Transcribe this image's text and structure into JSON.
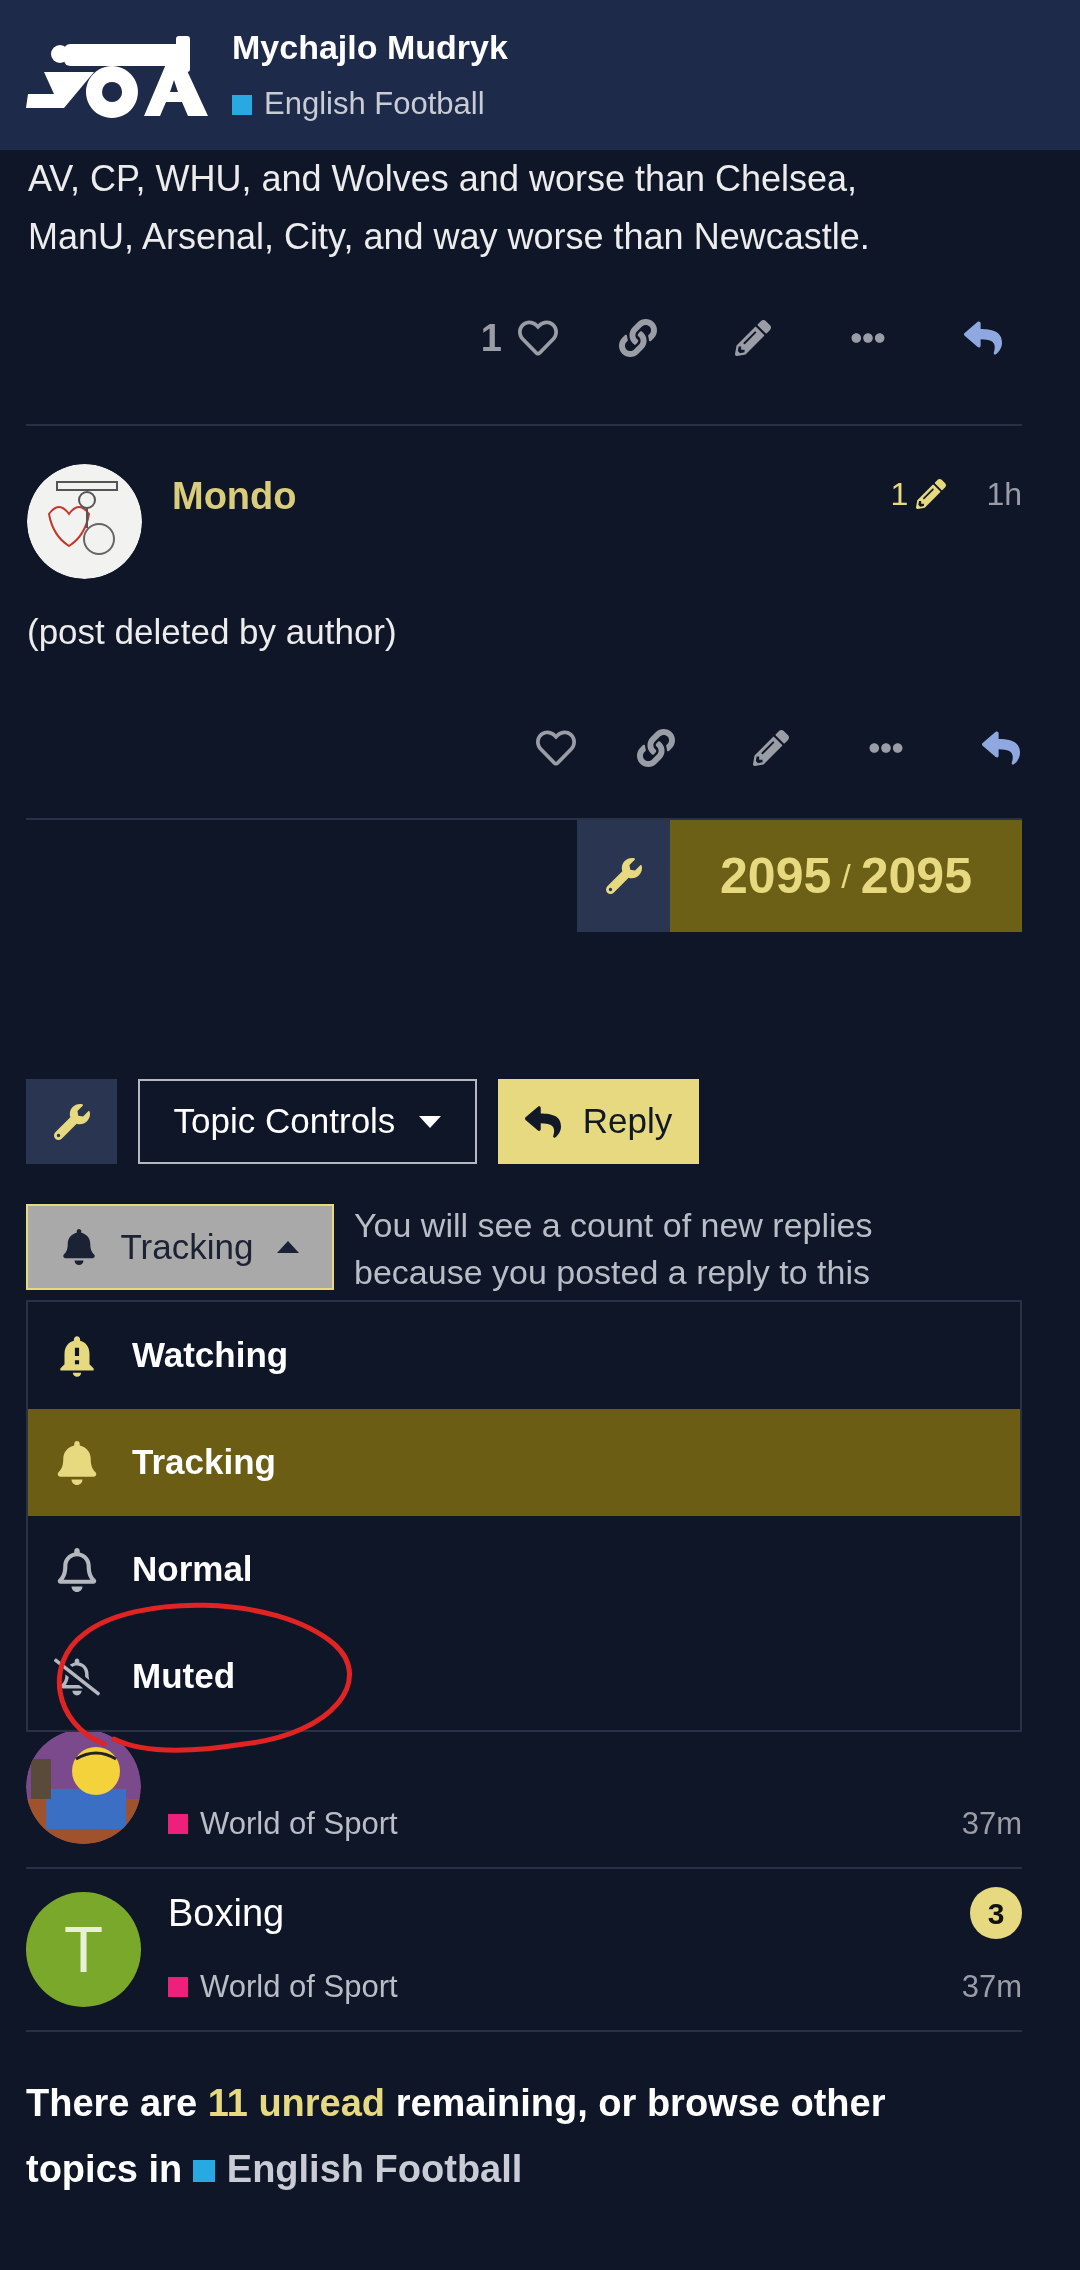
{
  "header": {
    "title": "Mychajlo Mudryk",
    "category": {
      "name": "English Football",
      "color": "#29a9e1"
    }
  },
  "posts": [
    {
      "text": "AV, CP, WHU, and Wolves and worse than Chelsea, ManU, Arsenal, City, and way worse than Newcastle.",
      "like_count": "1"
    },
    {
      "author": "Mondo",
      "edit_count": "1",
      "time": "1h",
      "text": "(post deleted by author)"
    }
  ],
  "progress": {
    "current": "2095",
    "separator": "/",
    "total": "2095"
  },
  "controls": {
    "topic_controls": "Topic Controls",
    "reply": "Reply"
  },
  "notification": {
    "button": "Tracking",
    "expanded": true,
    "description": "You will see a count of new replies because you posted a reply to this"
  },
  "levels": [
    {
      "kind": "watching",
      "label": "Watching",
      "selected": false
    },
    {
      "kind": "tracking",
      "label": "Tracking",
      "selected": true
    },
    {
      "kind": "normal",
      "label": "Normal",
      "selected": false
    },
    {
      "kind": "muted",
      "label": "Muted",
      "selected": false
    }
  ],
  "topics": [
    {
      "category": {
        "name": "World of Sport",
        "color": "#ed207b"
      },
      "time": "37m"
    },
    {
      "title": "Boxing",
      "avatar": {
        "kind": "letter",
        "letter": "T",
        "color": "#7aa82a"
      },
      "badge": "3",
      "category": {
        "name": "World of Sport",
        "color": "#ed207b"
      },
      "time": "37m"
    }
  ],
  "footer": {
    "before": "There are ",
    "unread_link": "11 unread",
    "after": " remaining, or browse other topics in ",
    "category": {
      "name": "English Football",
      "color": "#29a9e1"
    }
  }
}
